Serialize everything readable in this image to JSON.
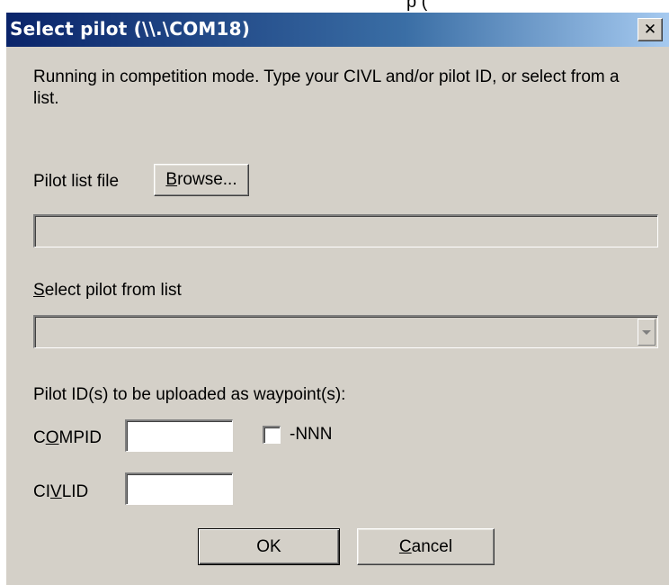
{
  "window": {
    "title": "Select pilot (\\\\.\\COM18)"
  },
  "intro_text": "Running in competition mode. Type your CIVL and/or pilot ID, or select from a list.",
  "pilot_list": {
    "label": "Pilot list file",
    "browse_button": {
      "prefix": "",
      "mnemonic": "B",
      "suffix": "rowse..."
    },
    "file_path_value": ""
  },
  "select_pilot": {
    "label": {
      "prefix": "",
      "mnemonic": "S",
      "suffix": "elect pilot from list"
    },
    "selected_value": ""
  },
  "ids_section": {
    "heading": "Pilot ID(s) to be uploaded as waypoint(s):",
    "compid": {
      "label": {
        "prefix": "C",
        "mnemonic": "O",
        "suffix": "MPID"
      },
      "value": ""
    },
    "nnn_checkbox": {
      "label": "-NNN",
      "checked": false
    },
    "civlid": {
      "label": {
        "prefix": "CI",
        "mnemonic": "V",
        "suffix": "LID"
      },
      "value": ""
    }
  },
  "buttons": {
    "ok": "OK",
    "cancel": {
      "prefix": "",
      "mnemonic": "C",
      "suffix": "ancel"
    }
  }
}
